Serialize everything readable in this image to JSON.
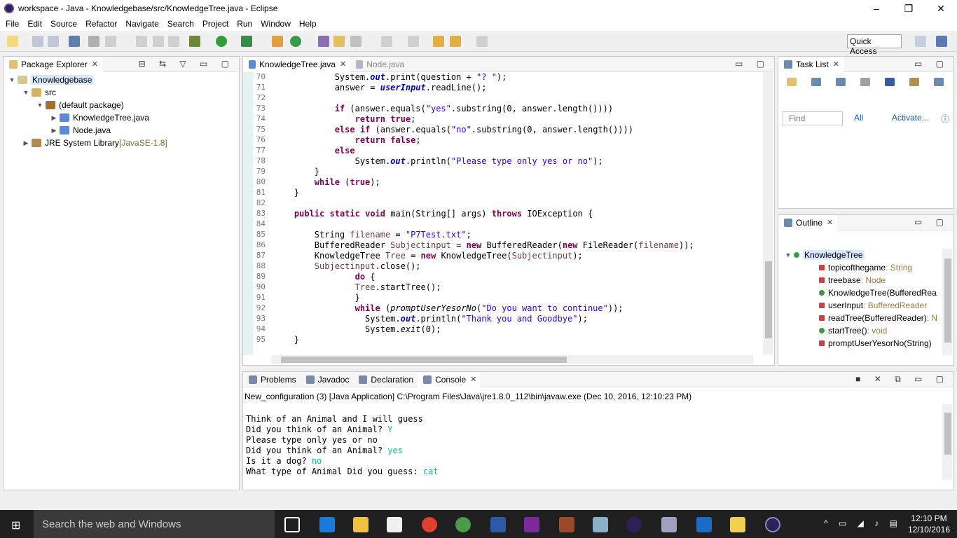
{
  "window": {
    "title": "workspace - Java - Knowledgebase/src/KnowledgeTree.java - Eclipse",
    "min": "–",
    "max": "❐",
    "close": "✕"
  },
  "menu": [
    "File",
    "Edit",
    "Source",
    "Refactor",
    "Navigate",
    "Search",
    "Project",
    "Run",
    "Window",
    "Help"
  ],
  "quick_access": "Quick Access",
  "package_explorer": {
    "tab": "Package Explorer",
    "tree": [
      {
        "label": "Knowledgebase",
        "depth": 0,
        "expanded": true,
        "selected": true,
        "icon": "project-icon"
      },
      {
        "label": "src",
        "depth": 1,
        "expanded": true,
        "icon": "source-folder-icon"
      },
      {
        "label": "(default package)",
        "depth": 2,
        "expanded": true,
        "icon": "package-icon"
      },
      {
        "label": "KnowledgeTree.java",
        "depth": 3,
        "expanded": false,
        "icon": "java-file-icon"
      },
      {
        "label": "Node.java",
        "depth": 3,
        "expanded": false,
        "icon": "java-file-icon"
      },
      {
        "label": "JRE System Library",
        "suffix": " [JavaSE-1.8]",
        "depth": 1,
        "expanded": false,
        "icon": "library-icon"
      }
    ]
  },
  "editor": {
    "tabs": [
      {
        "label": "KnowledgeTree.java",
        "active": true
      },
      {
        "label": "Node.java",
        "active": false
      }
    ],
    "lines": [
      {
        "n": "70",
        "html": "            System.<span class='fld'>out</span>.print(question + <span class='str'>\"? \"</span>);"
      },
      {
        "n": "71",
        "html": "            answer = <span class='fld'>userInput</span>.readLine();"
      },
      {
        "n": "72",
        "html": ""
      },
      {
        "n": "73",
        "html": "            <span class='kw'>if</span> (answer.equals(<span class='str'>\"yes\"</span>.substring(0, answer.length())))"
      },
      {
        "n": "74",
        "html": "                <span class='kw'>return</span> <span class='kw'>true</span>;"
      },
      {
        "n": "75",
        "html": "            <span class='kw'>else</span> <span class='kw'>if</span> (answer.equals(<span class='str'>\"no\"</span>.substring(0, answer.length())))"
      },
      {
        "n": "76",
        "html": "                <span class='kw'>return</span> <span class='kw'>false</span>;"
      },
      {
        "n": "77",
        "html": "            <span class='kw'>else</span>"
      },
      {
        "n": "78",
        "html": "                System.<span class='fld'>out</span>.println(<span class='str'>\"Please type only yes or no\"</span>);"
      },
      {
        "n": "79",
        "html": "        }"
      },
      {
        "n": "80",
        "html": "        <span class='kw'>while</span> (<span class='kw'>true</span>);"
      },
      {
        "n": "81",
        "html": "    }"
      },
      {
        "n": "82",
        "html": ""
      },
      {
        "n": "83",
        "html": "    <span class='kw'>public</span> <span class='kw'>static</span> <span class='kw'>void</span> main(String[] args) <span class='kw'>throws</span> IOException {"
      },
      {
        "n": "84",
        "html": ""
      },
      {
        "n": "85",
        "html": "        String <span class='var'>filename</span> = <span class='str'>\"P7Test.txt\"</span>;"
      },
      {
        "n": "86",
        "html": "        BufferedReader <span class='var'>Subjectinput</span> = <span class='kw'>new</span> BufferedReader(<span class='kw'>new</span> FileReader(<span class='var'>filename</span>));"
      },
      {
        "n": "87",
        "html": "        KnowledgeTree <span class='var'>Tree</span> = <span class='kw'>new</span> KnowledgeTree(<span class='var'>Subjectinput</span>);"
      },
      {
        "n": "88",
        "html": "        <span class='var'>Subjectinput</span>.close();"
      },
      {
        "n": "89",
        "html": "                <span class='kw'>do</span> {"
      },
      {
        "n": "90",
        "html": "                <span class='var'>Tree</span>.startTree();"
      },
      {
        "n": "91",
        "html": "                }"
      },
      {
        "n": "92",
        "html": "                <span class='kw'>while</span> (<span class='ital'>promptUserYesorNo</span>(<span class='str'>\"Do you want to continue\"</span>));"
      },
      {
        "n": "93",
        "html": "                  System.<span class='fld'>out</span>.println(<span class='str'>\"Thank you and Goodbye\"</span>);"
      },
      {
        "n": "94",
        "html": "                  System.<span class='ital'>exit</span>(0);"
      },
      {
        "n": "95",
        "html": "    }"
      }
    ]
  },
  "task_list": {
    "tab": "Task List",
    "find_placeholder": "Find",
    "all": "All",
    "activate": "Activate..."
  },
  "outline": {
    "tab": "Outline",
    "items": [
      {
        "label": "KnowledgeTree",
        "type": "",
        "depth": 0
      },
      {
        "label": "topicofthegame",
        "type": " : String",
        "depth": 1
      },
      {
        "label": "treebase",
        "type": " : Node",
        "depth": 1
      },
      {
        "label": "KnowledgeTree(BufferedRea",
        "type": "",
        "depth": 1
      },
      {
        "label": "userInput",
        "type": " : BufferedReader",
        "depth": 1
      },
      {
        "label": "readTree(BufferedReader)",
        "type": " : N",
        "depth": 1
      },
      {
        "label": "startTree()",
        "type": " : void",
        "depth": 1
      },
      {
        "label": "promptUserYesorNo(String)",
        "type": "",
        "depth": 1
      }
    ]
  },
  "bottom": {
    "tabs": [
      {
        "label": "Problems"
      },
      {
        "label": "Javadoc"
      },
      {
        "label": "Declaration"
      },
      {
        "label": "Console",
        "active": true
      }
    ],
    "console_header": "New_configuration (3) [Java Application] C:\\Program Files\\Java\\jre1.8.0_112\\bin\\javaw.exe (Dec 10, 2016, 12:10:23 PM)",
    "console_lines": [
      {
        "text": "Think of an Animal and I will guess",
        "input": ""
      },
      {
        "text": "Did you think of an Animal? ",
        "input": "Y"
      },
      {
        "text": "Please type only yes or no",
        "input": ""
      },
      {
        "text": "Did you think of an Animal? ",
        "input": "yes"
      },
      {
        "text": "Is it a dog? ",
        "input": "no"
      },
      {
        "text": "What type of Animal Did you guess: ",
        "input": "cat"
      }
    ]
  },
  "taskbar": {
    "search": "Search the web and Windows",
    "time": "12:10 PM",
    "date": "12/10/2016"
  }
}
